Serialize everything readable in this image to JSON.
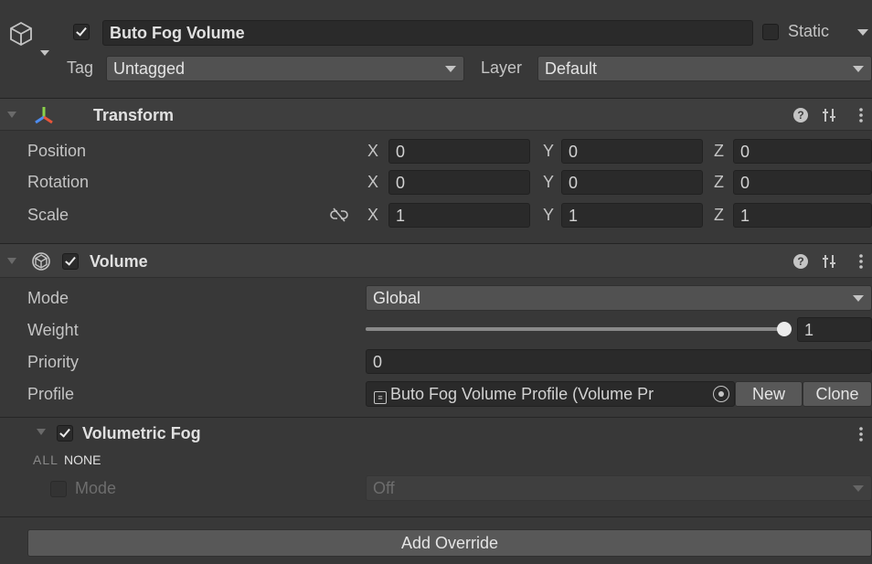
{
  "gameobject": {
    "name": "Buto Fog Volume",
    "static_label": "Static",
    "tag_label": "Tag",
    "tag_value": "Untagged",
    "layer_label": "Layer",
    "layer_value": "Default"
  },
  "transform": {
    "title": "Transform",
    "rows": [
      {
        "label": "Position",
        "x": "0",
        "y": "0",
        "z": "0"
      },
      {
        "label": "Rotation",
        "x": "0",
        "y": "0",
        "z": "0"
      },
      {
        "label": "Scale",
        "x": "1",
        "y": "1",
        "z": "1"
      }
    ],
    "axis_x": "X",
    "axis_y": "Y",
    "axis_z": "Z"
  },
  "volume": {
    "title": "Volume",
    "mode_label": "Mode",
    "mode_value": "Global",
    "weight_label": "Weight",
    "weight_value": "1",
    "weight_fraction": 1.0,
    "priority_label": "Priority",
    "priority_value": "0",
    "profile_label": "Profile",
    "profile_value": "Buto Fog Volume Profile (Volume Pr",
    "new_label": "New",
    "clone_label": "Clone"
  },
  "override": {
    "title": "Volumetric Fog",
    "all_label": "ALL",
    "none_label": "NONE",
    "mode_label": "Mode",
    "mode_value": "Off",
    "add_label": "Add Override"
  },
  "colors": {
    "background": "#383838",
    "header": "#3e3e3e",
    "field": "#2a2a2a"
  }
}
